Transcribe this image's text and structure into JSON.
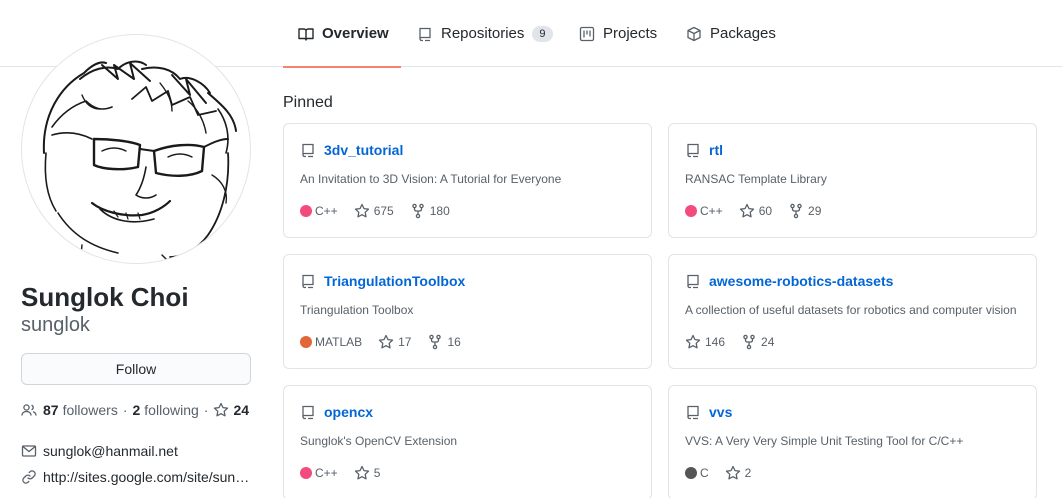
{
  "nav": {
    "tabs": [
      {
        "label": "Overview",
        "icon": "book-icon",
        "active": true
      },
      {
        "label": "Repositories",
        "icon": "repo-icon",
        "count": "9"
      },
      {
        "label": "Projects",
        "icon": "project-icon"
      },
      {
        "label": "Packages",
        "icon": "package-icon"
      }
    ]
  },
  "profile": {
    "fullname": "Sunglok Choi",
    "username": "sunglok",
    "follow_label": "Follow",
    "followers_count": "87",
    "followers_label": "followers",
    "following_count": "2",
    "following_label": "following",
    "stars_count": "24",
    "email": "sunglok@hanmail.net",
    "website": "http://sites.google.com/site/sun…"
  },
  "pinned": {
    "title": "Pinned",
    "repos": [
      {
        "name": "3dv_tutorial",
        "description": "An Invitation to 3D Vision: A Tutorial for Everyone",
        "language": "C++",
        "language_color": "#f34b7d",
        "stars": "675",
        "forks": "180"
      },
      {
        "name": "rtl",
        "description": "RANSAC Template Library",
        "language": "C++",
        "language_color": "#f34b7d",
        "stars": "60",
        "forks": "29"
      },
      {
        "name": "TriangulationToolbox",
        "description": "Triangulation Toolbox",
        "language": "MATLAB",
        "language_color": "#e16737",
        "stars": "17",
        "forks": "16"
      },
      {
        "name": "awesome-robotics-datasets",
        "description": "A collection of useful datasets for robotics and computer vision",
        "language": "",
        "language_color": "",
        "stars": "146",
        "forks": "24"
      },
      {
        "name": "opencx",
        "description": "Sunglok's OpenCV Extension",
        "language": "C++",
        "language_color": "#f34b7d",
        "stars": "5",
        "forks": ""
      },
      {
        "name": "vvs",
        "description": "VVS: A Very Very Simple Unit Testing Tool for C/C++",
        "language": "C",
        "language_color": "#555555",
        "stars": "2",
        "forks": ""
      }
    ]
  },
  "colors": {
    "link": "#0366d6",
    "tab_underline": "#f9826c",
    "muted": "#586069"
  }
}
